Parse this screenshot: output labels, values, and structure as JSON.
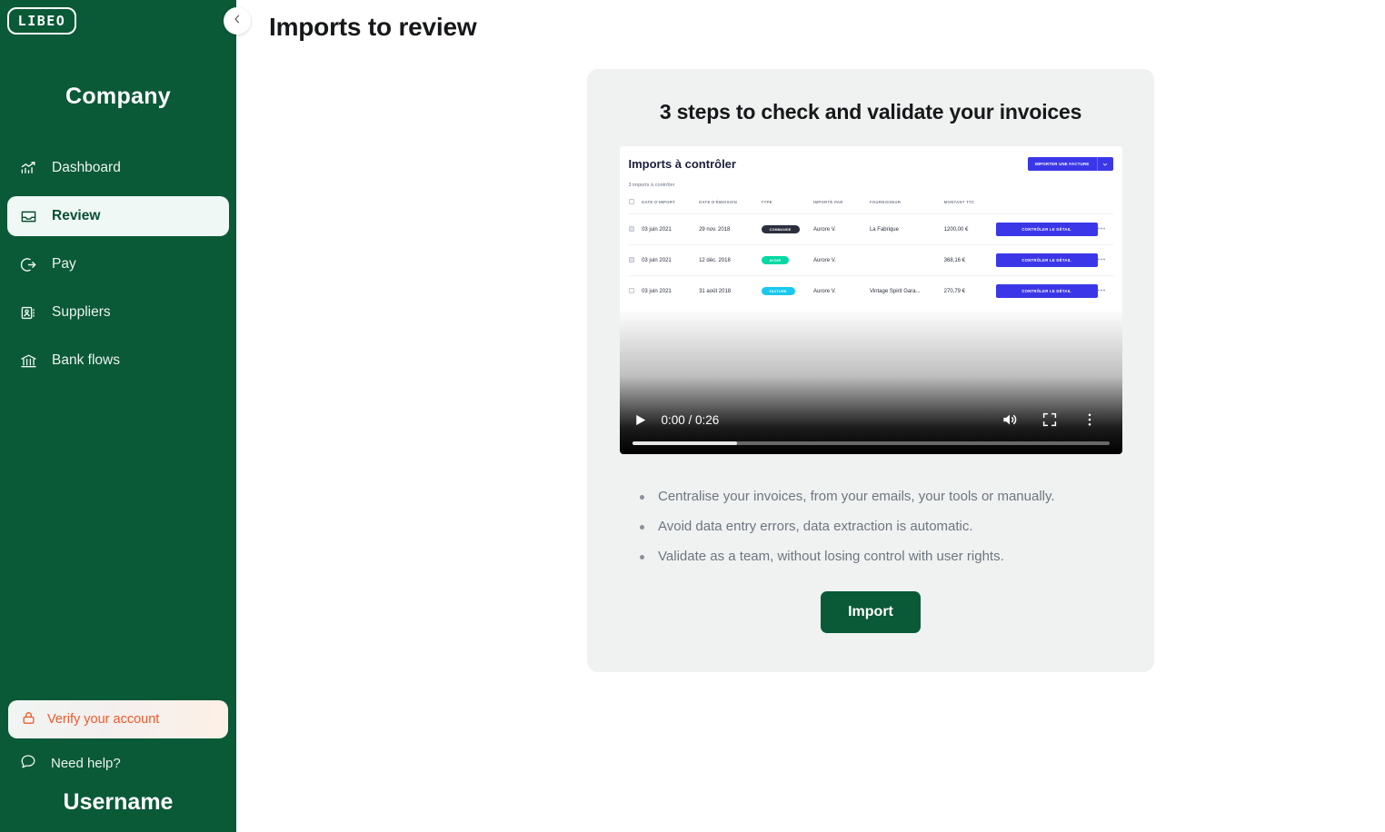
{
  "sidebar": {
    "logo": "LIBEO",
    "company": "Company",
    "collapse_icon": "chevron-left-icon",
    "items": [
      {
        "label": "Dashboard",
        "icon": "analytics-icon",
        "active": false
      },
      {
        "label": "Review",
        "icon": "inbox-tray-icon",
        "active": true
      },
      {
        "label": "Pay",
        "icon": "arrow-out-circle-icon",
        "active": false
      },
      {
        "label": "Suppliers",
        "icon": "contact-card-icon",
        "active": false
      },
      {
        "label": "Bank flows",
        "icon": "bank-icon",
        "active": false
      }
    ],
    "verify": {
      "label": "Verify your account",
      "icon": "lock-icon",
      "color": "#f05a28"
    },
    "need_help": {
      "label": "Need help?",
      "icon": "chat-bubble-icon"
    },
    "username": "Username",
    "bg_color": "#0a5937",
    "active_bg": "#eff8f4"
  },
  "header": {
    "title": "Imports to review"
  },
  "card": {
    "title": "3 steps to check and validate your invoices",
    "bg_color": "#eff2f1",
    "bullets": [
      "Centralise your invoices, from your emails, your tools or manually.",
      "Avoid data entry errors, data extraction is automatic.",
      "Validate as a team, without losing control with user rights."
    ],
    "import_button": "Import"
  },
  "video": {
    "current_time": "0:00",
    "duration": "0:26",
    "time_display": "0:00 / 0:26",
    "play_icon": "play-icon",
    "volume_icon": "volume-icon",
    "fullscreen_icon": "fullscreen-icon",
    "more_icon": "more-vertical-icon",
    "progress_percent": 0,
    "buffered_percent": 22,
    "poster": {
      "title": "Imports à contrôler",
      "subtitle": "3 imports à contrôler",
      "import_button": "IMPORTER UNE FACTURE",
      "import_button_color": "#3b37e8",
      "dropdown_icon": "chevron-down-icon",
      "columns": [
        "DATE D'IMPORT",
        "DATE D'ÉMISSION",
        "TYPE",
        "IMPORTÉ PAR",
        "FOURNISSEUR",
        "MONTANT TTC"
      ],
      "rows": [
        {
          "checked": true,
          "date_import": "03 juin 2021",
          "date_emission": "29 nov. 2018",
          "type": "COMMANDE",
          "type_style": "dark",
          "imported_by": "Aurore V.",
          "supplier": "La Fabrique",
          "amount": "1200,00 €",
          "action": "CONTRÔLER LE DÉTAIL"
        },
        {
          "checked": true,
          "date_import": "03 juin 2021",
          "date_emission": "12 déc. 2018",
          "type": "AVOIR",
          "type_style": "green",
          "imported_by": "Aurore V.",
          "supplier": "",
          "amount": "368,16 €",
          "action": "CONTRÔLER LE DÉTAIL"
        },
        {
          "checked": false,
          "date_import": "03 juin 2021",
          "date_emission": "31 août 2018",
          "type": "FACTURE",
          "type_style": "cyan",
          "imported_by": "Aurore V.",
          "supplier": "Vintage Spirit Gara...",
          "amount": "270,79 €",
          "action": "CONTRÔLER LE DÉTAIL"
        }
      ],
      "row_menu_icon": "ellipsis-icon"
    }
  }
}
